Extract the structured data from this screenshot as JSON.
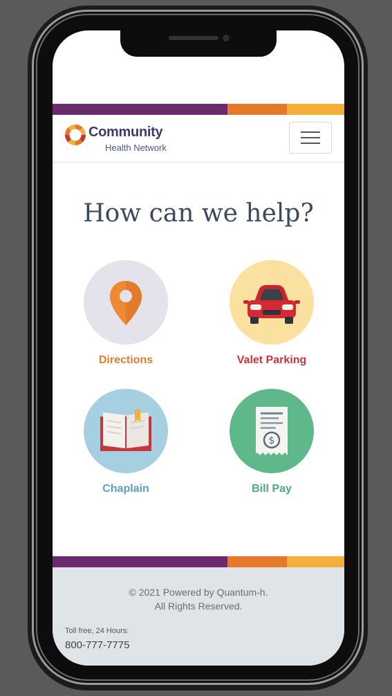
{
  "brand": {
    "name": "Community",
    "subtitle": "Health Network"
  },
  "hero": {
    "heading": "How can we help?"
  },
  "tiles": [
    {
      "label": "Directions",
      "icon": "location-pin-icon",
      "label_color": "#e07d2e",
      "circle_color": "#e4e2ea"
    },
    {
      "label": "Valet Parking",
      "icon": "red-car-icon",
      "label_color": "#c8353a",
      "circle_color": "#fbe1a0"
    },
    {
      "label": "Chaplain",
      "icon": "open-book-icon",
      "label_color": "#5b9dc0",
      "circle_color": "#a6cfe1"
    },
    {
      "label": "Bill Pay",
      "icon": "receipt-dollar-icon",
      "label_color": "#4caa7c",
      "circle_color": "#5fb889"
    }
  ],
  "footer": {
    "copyright_line1": "© 2021 Powered by Quantum-h.",
    "copyright_line2": "All Rights Reserved.",
    "tollfree_label": "Toll free, 24 Hours:",
    "phone": "800-777-7775"
  },
  "colors": {
    "stripe_purple": "#6a2a6b",
    "stripe_orange": "#e6782b",
    "stripe_yellow": "#f2b03a",
    "heading": "#3b4a5e",
    "footer_bg": "#dfe4e8"
  }
}
